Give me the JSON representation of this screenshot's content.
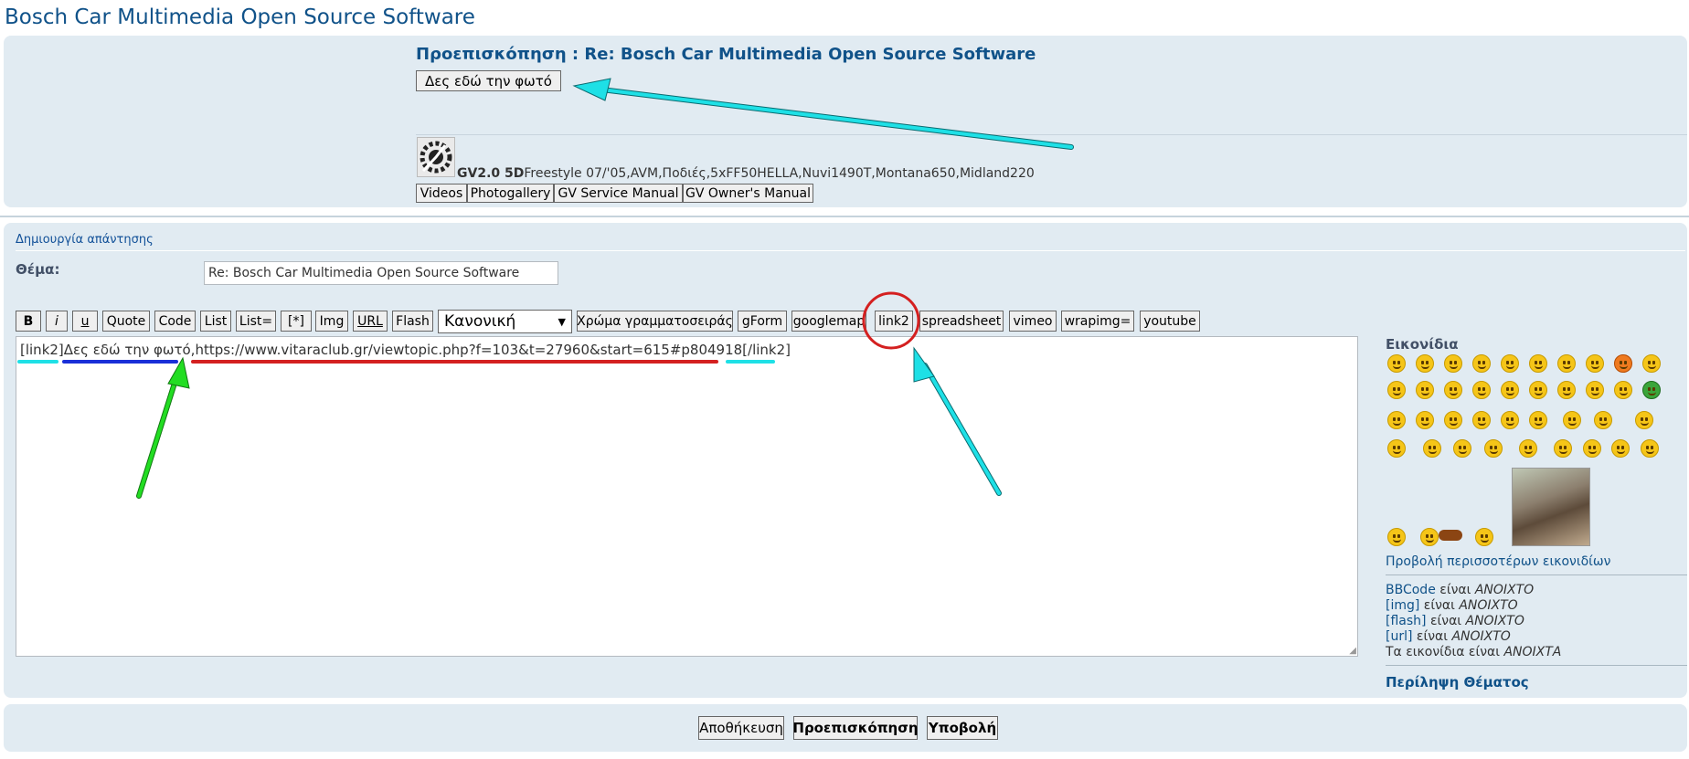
{
  "page": {
    "title": "Bosch Car Multimedia Open Source Software"
  },
  "preview": {
    "title": "Προεπισκόπηση : Re: Bosch Car Multimedia Open Source Software",
    "link_button": "Δες εδώ την φωτό",
    "signature": {
      "model": "GV2.0 5D",
      "details": "Freestyle 07/'05,AVM,Ποδιές,5xFF50HELLA,Nuvi1490T,Montana650,Midland220",
      "buttons": [
        "Videos",
        "Photogallery",
        "GV Service Manual",
        "GV Owner's Manual"
      ]
    }
  },
  "reply": {
    "heading": "Δημιουργία απάντησης",
    "subject_label": "Θέμα:",
    "subject_value": "Re: Bosch Car Multimedia Open Source Software",
    "toolbar": {
      "bold": "B",
      "italic": "i",
      "underline": "u",
      "buttons": [
        "Quote",
        "Code",
        "List",
        "List=",
        "[*]",
        "Img",
        "URL",
        "Flash"
      ],
      "size_select": "Κανονική",
      "buttons2": [
        "Χρώμα γραμματοσειράς",
        "gForm",
        "googlemap",
        "link2",
        "spreadsheet",
        "vimeo",
        "wrapimg=",
        "youtube"
      ]
    },
    "editor_text": "[link2]Δες εδώ την φωτό,https://www.vitaraclub.gr/viewtopic.php?f=103&t=27960&start=615#p804918[/link2]"
  },
  "smilies": {
    "heading": "Εικονίδια",
    "more_link": "Προβολή περισσοτέρων εικονιδίων"
  },
  "status": {
    "bbcode": {
      "label": "BBCode",
      "is": "είναι",
      "value": "ΑΝΟΙΧΤΟ"
    },
    "img": {
      "label": "[img]",
      "is": "είναι",
      "value": "ΑΝΟΙΧΤΟ"
    },
    "flash": {
      "label": "[flash]",
      "is": "είναι",
      "value": "ΑΝΟΙΧΤΟ"
    },
    "url": {
      "label": "[url]",
      "is": "είναι",
      "value": "ΑΝΟΙΧΤΟ"
    },
    "smilies": {
      "label": "Τα εικονίδια",
      "is": "είναι",
      "value": "ΑΝΟΙΧΤΑ"
    }
  },
  "topic_summary": "Περίληψη Θέματος",
  "actions": {
    "save": "Αποθήκευση",
    "preview": "Προεπισκόπηση",
    "submit": "Υποβολή"
  },
  "colors": {
    "panel": "#e1ebf2",
    "link": "#105289",
    "annotation_cyan": "#1ee0e6",
    "annotation_green": "#22dd22",
    "annotation_red": "#d42020",
    "annotation_blue": "#1a2fd8"
  }
}
